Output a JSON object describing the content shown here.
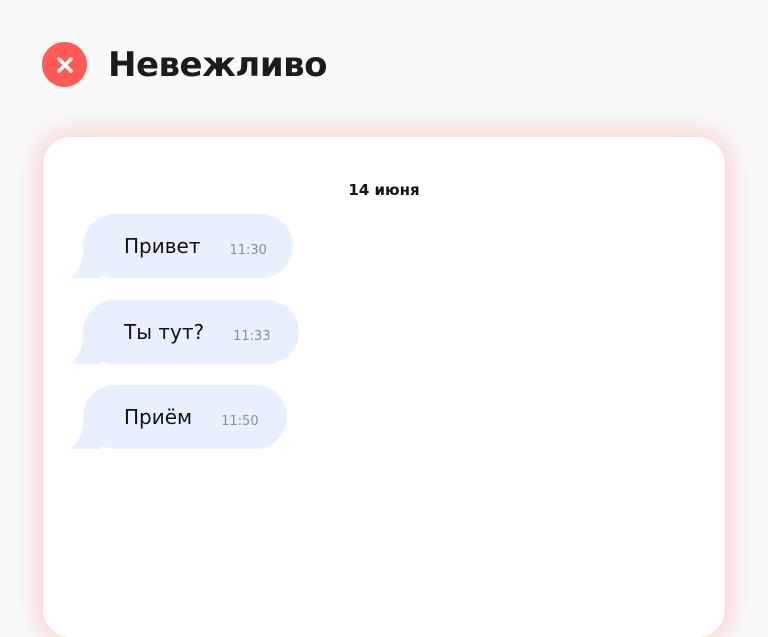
{
  "header": {
    "title": "Невежливо",
    "icon": "close-icon",
    "icon_color": "#ff5b55"
  },
  "chat": {
    "date": "14 июня",
    "bubble_color": "#e8efff",
    "messages": [
      {
        "text": "Привет",
        "time": "11:30"
      },
      {
        "text": "Ты тут?",
        "time": "11:33"
      },
      {
        "text": "Приём",
        "time": "11:50"
      }
    ]
  }
}
